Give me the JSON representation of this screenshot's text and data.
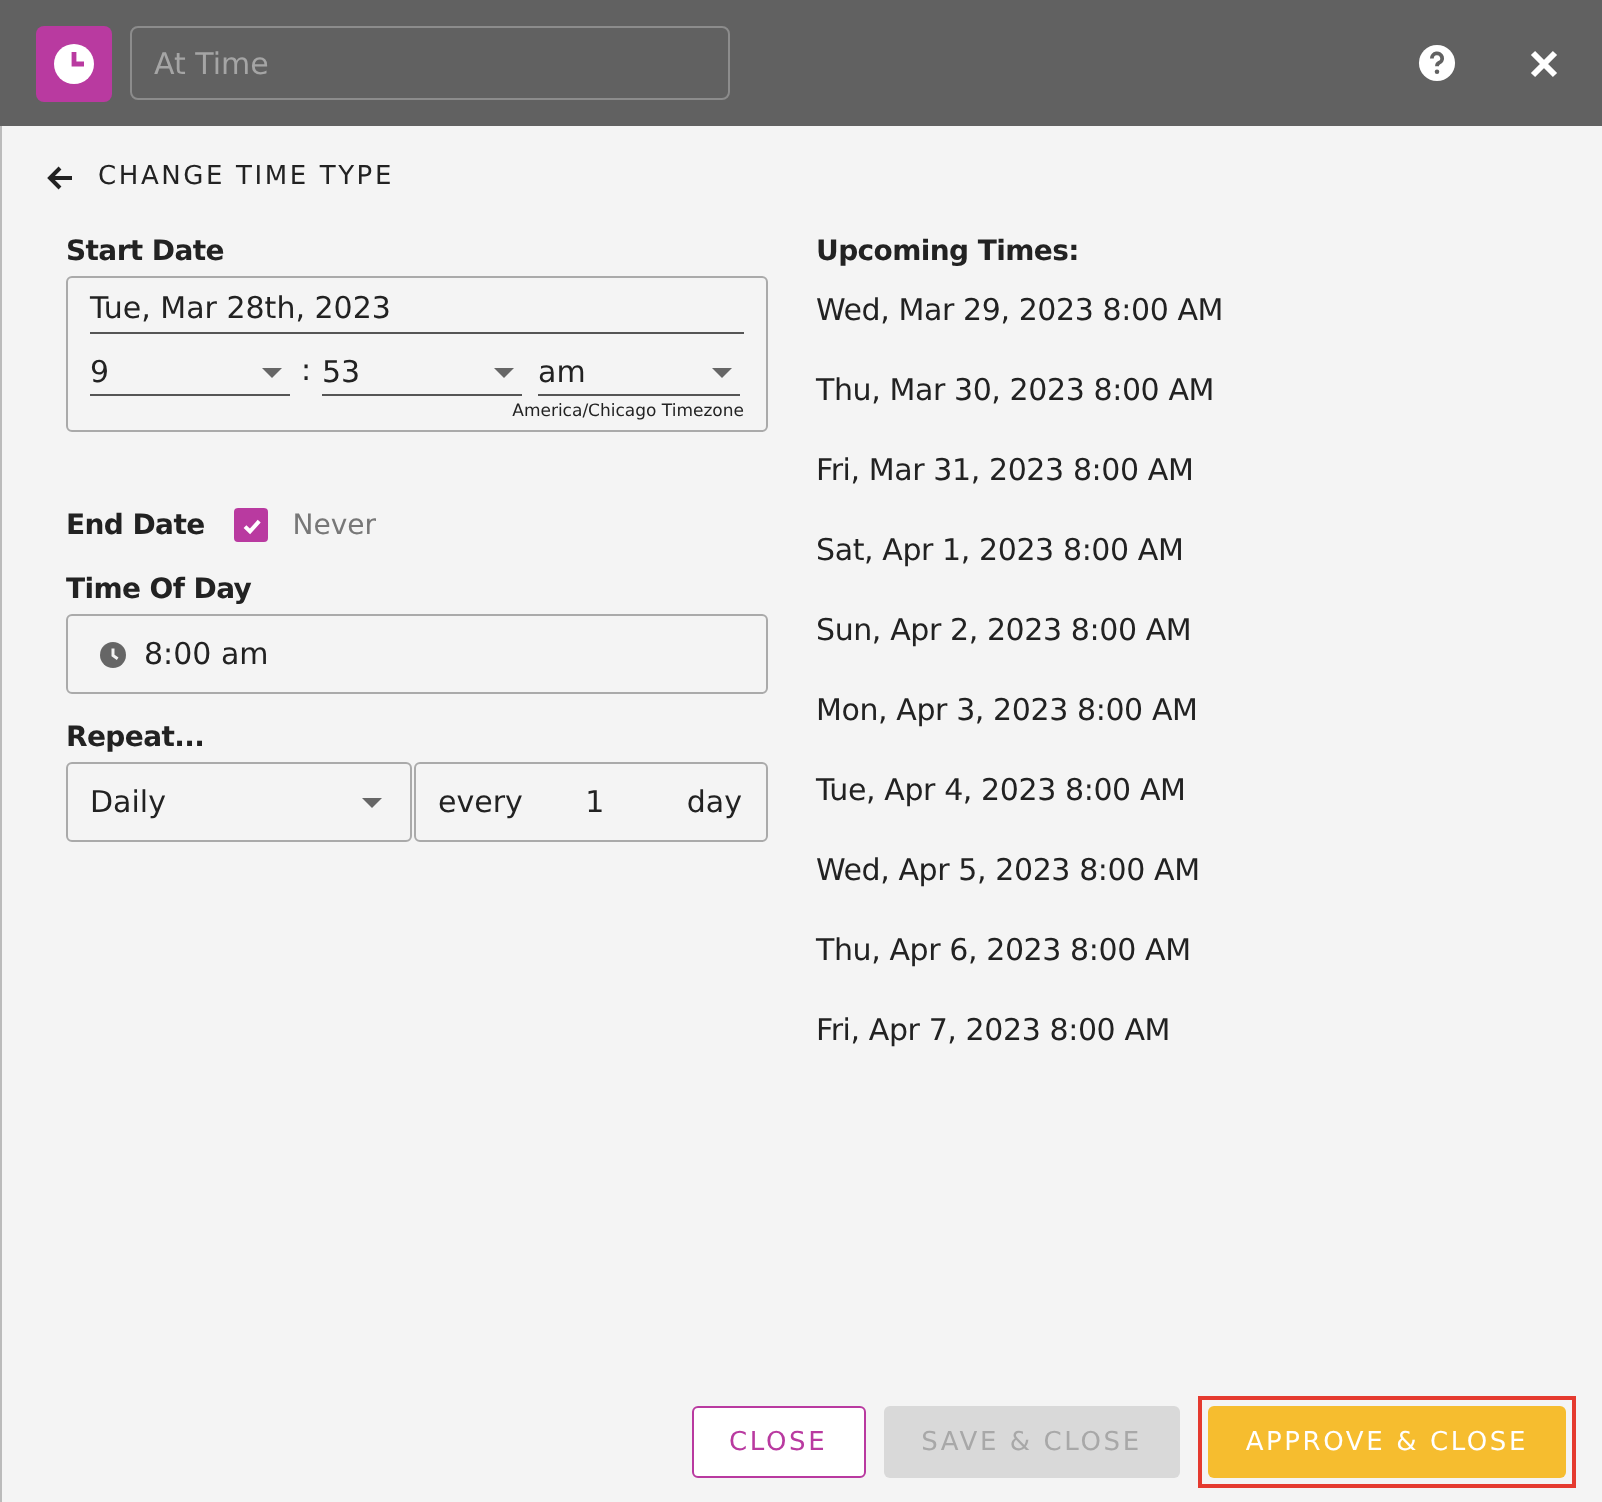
{
  "header": {
    "title_placeholder": "At Time"
  },
  "back_link": "CHANGE TIME TYPE",
  "start_date": {
    "label": "Start Date",
    "date": "Tue, Mar 28th, 2023",
    "hour": "9",
    "separator": ":",
    "minute": "53",
    "meridiem": "am",
    "timezone": "America/Chicago Timezone"
  },
  "end_date": {
    "label": "End Date",
    "never_checked": true,
    "never_label": "Never"
  },
  "time_of_day": {
    "label": "Time Of Day",
    "value": "8:00 am"
  },
  "repeat": {
    "label": "Repeat...",
    "frequency": "Daily",
    "every_label": "every",
    "interval": "1",
    "unit": "day"
  },
  "upcoming": {
    "title": "Upcoming Times:",
    "times": [
      "Wed, Mar 29, 2023 8:00 AM",
      "Thu, Mar 30, 2023 8:00 AM",
      "Fri, Mar 31, 2023 8:00 AM",
      "Sat, Apr 1, 2023 8:00 AM",
      "Sun, Apr 2, 2023 8:00 AM",
      "Mon, Apr 3, 2023 8:00 AM",
      "Tue, Apr 4, 2023 8:00 AM",
      "Wed, Apr 5, 2023 8:00 AM",
      "Thu, Apr 6, 2023 8:00 AM",
      "Fri, Apr 7, 2023 8:00 AM"
    ]
  },
  "buttons": [
    {
      "label": "CLOSE",
      "kind": "outline",
      "disabled": false,
      "highlighted": false
    },
    {
      "label": "SAVE & CLOSE",
      "kind": "filled",
      "disabled": true,
      "highlighted": false
    },
    {
      "label": "APPROVE & CLOSE",
      "kind": "primary",
      "disabled": false,
      "highlighted": true
    }
  ]
}
